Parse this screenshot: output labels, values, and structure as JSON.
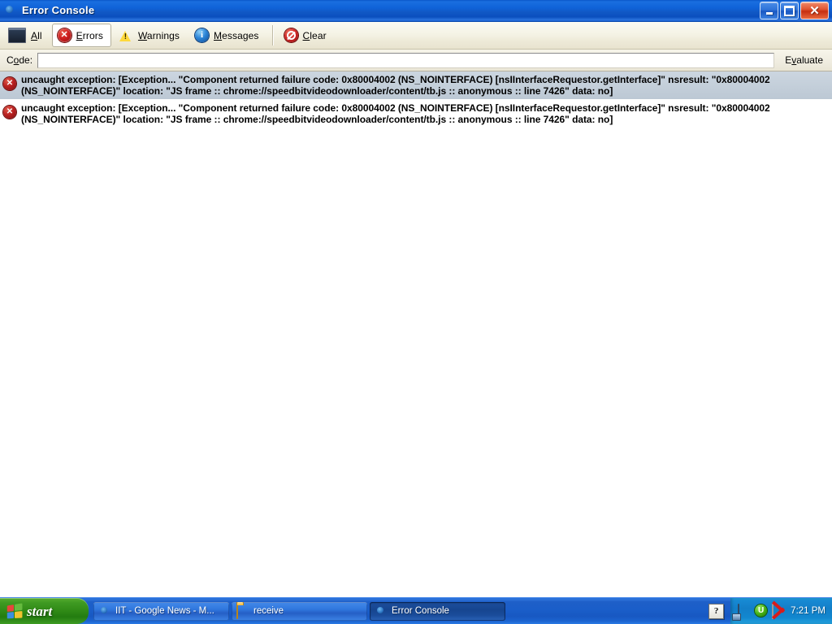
{
  "window": {
    "title": "Error Console",
    "icon": "firefox-icon",
    "controls": {
      "minimize": "minimize-button",
      "restore": "restore-button",
      "close": "close-button"
    }
  },
  "toolbar": {
    "buttons": [
      {
        "id": "all",
        "label": "All",
        "accesskey": "A",
        "icon": "console-window-icon",
        "checked": false
      },
      {
        "id": "errors",
        "label": "Errors",
        "accesskey": "E",
        "icon": "error-x-circle-icon",
        "checked": true
      },
      {
        "id": "warnings",
        "label": "Warnings",
        "accesskey": "W",
        "icon": "warning-triangle-icon",
        "checked": false
      },
      {
        "id": "messages",
        "label": "Messages",
        "accesskey": "M",
        "icon": "info-circle-icon",
        "checked": false
      }
    ],
    "clear": {
      "id": "clear",
      "label": "Clear",
      "accesskey": "C",
      "icon": "no-entry-icon"
    }
  },
  "codebar": {
    "label": "Code:",
    "label_accesskey": "o",
    "input_value": "",
    "input_placeholder": "",
    "evaluate_label": "Evaluate",
    "evaluate_accesskey": "v"
  },
  "messages": [
    {
      "icon": "error-x-circle-icon",
      "selected": true,
      "text": "uncaught exception: [Exception... \"Component returned failure code: 0x80004002 (NS_NOINTERFACE) [nsIInterfaceRequestor.getInterface]\"  nsresult: \"0x80004002 (NS_NOINTERFACE)\"  location: \"JS frame :: chrome://speedbitvideodownloader/content/tb.js :: anonymous :: line 7426\"  data: no]"
    },
    {
      "icon": "error-x-circle-icon",
      "selected": false,
      "text": "uncaught exception: [Exception... \"Component returned failure code: 0x80004002 (NS_NOINTERFACE) [nsIInterfaceRequestor.getInterface]\"  nsresult: \"0x80004002 (NS_NOINTERFACE)\"  location: \"JS frame :: chrome://speedbitvideodownloader/content/tb.js :: anonymous :: line 7426\"  data: no]"
    }
  ],
  "taskbar": {
    "start_label": "start",
    "start_icon": "windows-flag-icon",
    "tasks": [
      {
        "label": "IIT - Google News - M...",
        "icon": "firefox-icon",
        "active": false
      },
      {
        "label": "receive",
        "icon": "folder-icon",
        "active": false
      },
      {
        "label": "Error Console",
        "icon": "firefox-icon",
        "active": true
      }
    ],
    "help_chip": "?",
    "tray_icons": [
      {
        "name": "network-connection-icon",
        "glyph": ""
      },
      {
        "name": "shield-update-icon",
        "glyph": "U"
      },
      {
        "name": "kaspersky-antivirus-icon",
        "glyph": ""
      }
    ],
    "clock": "7:21 PM"
  },
  "colors": {
    "titlebar_blue": "#0f62d8",
    "toolbar_beige": "#f4f2e4",
    "selected_row": "#c4cfda",
    "error_red": "#b71f1f",
    "warning_yellow": "#ffd93b",
    "info_blue": "#2e86d8",
    "taskbar_blue": "#1a5ec9",
    "start_green": "#2f8a16",
    "tray_blue": "#137fc8"
  }
}
